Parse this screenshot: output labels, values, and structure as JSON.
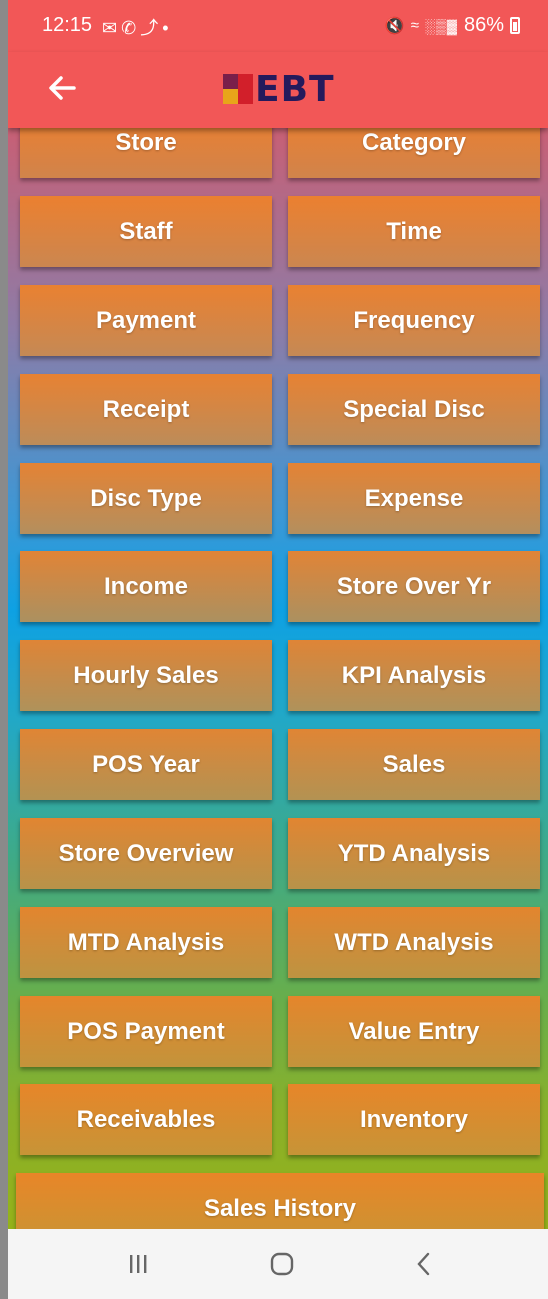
{
  "status_bar": {
    "time": "12:15",
    "notification_icons": [
      "gmail-icon",
      "whatsapp-icon",
      "missed-call-icon",
      "dot-icon"
    ],
    "battery_percent": "86%"
  },
  "app_bar": {
    "logo_text": "EBT",
    "back_icon": "arrow-left-icon",
    "logo_colors": [
      "#e8a51a",
      "#d21f2a",
      "#7a1f4a",
      "#241a5c"
    ]
  },
  "menu": {
    "rows": [
      [
        "Store",
        "Category"
      ],
      [
        "Staff",
        "Time"
      ],
      [
        "Payment",
        "Frequency"
      ],
      [
        "Receipt",
        "Special Disc"
      ],
      [
        "Disc Type",
        "Expense"
      ],
      [
        "Income",
        "Store Over Yr"
      ],
      [
        "Hourly Sales",
        "KPI Analysis"
      ],
      [
        "POS Year",
        "Sales"
      ],
      [
        "Store Overview",
        "YTD Analysis"
      ],
      [
        "MTD Analysis",
        "WTD Analysis"
      ],
      [
        "POS Payment",
        "Value Entry"
      ],
      [
        "Receivables",
        "Inventory"
      ]
    ],
    "full_width": "Sales History"
  },
  "nav_bar": {
    "recents_icon": "recents-icon",
    "home_icon": "home-icon",
    "back_icon": "back-chevron-icon"
  }
}
